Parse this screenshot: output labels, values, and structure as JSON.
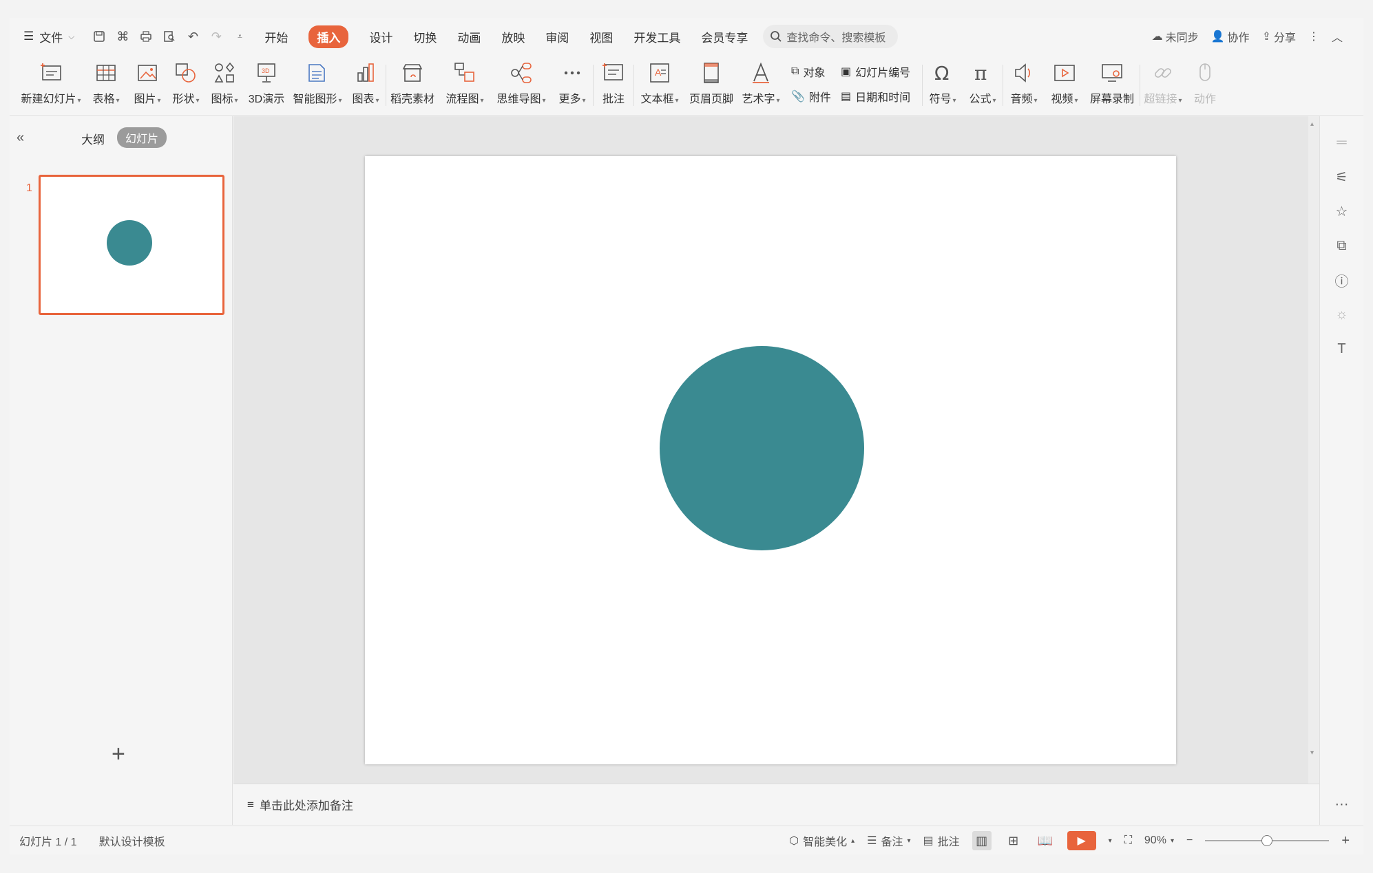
{
  "colors": {
    "accent": "#e8643c",
    "shape": "#3a8a91"
  },
  "menubar": {
    "file_label": "文件",
    "tabs": [
      "开始",
      "插入",
      "设计",
      "切换",
      "动画",
      "放映",
      "审阅",
      "视图",
      "开发工具",
      "会员专享"
    ],
    "active_tab": "插入",
    "search_placeholder": "查找命令、搜索模板",
    "right": {
      "sync": "未同步",
      "collab": "协作",
      "share": "分享"
    }
  },
  "ribbon": {
    "new_slide": "新建幻灯片",
    "table": "表格",
    "picture": "图片",
    "shape": "形状",
    "icon": "图标",
    "demo3d": "3D演示",
    "smartart": "智能图形",
    "chart": "图表",
    "material": "稻壳素材",
    "flowchart": "流程图",
    "mindmap": "思维导图",
    "more": "更多",
    "comment": "批注",
    "textbox": "文本框",
    "header_footer": "页眉页脚",
    "wordart": "艺术字",
    "object": "对象",
    "attachment": "附件",
    "slide_number": "幻灯片编号",
    "datetime": "日期和时间",
    "symbol": "符号",
    "formula": "公式",
    "audio": "音频",
    "video": "视频",
    "screen_record": "屏幕录制",
    "hyperlink": "超链接",
    "action": "动作"
  },
  "leftpanel": {
    "tab_outline": "大纲",
    "tab_slides": "幻灯片",
    "slide_number": "1",
    "add": "+"
  },
  "notes": {
    "placeholder": "单击此处添加备注"
  },
  "statusbar": {
    "slide_info": "幻灯片 1 / 1",
    "template": "默认设计模板",
    "beautify": "智能美化",
    "notes": "备注",
    "comments": "批注",
    "zoom": "90%"
  }
}
